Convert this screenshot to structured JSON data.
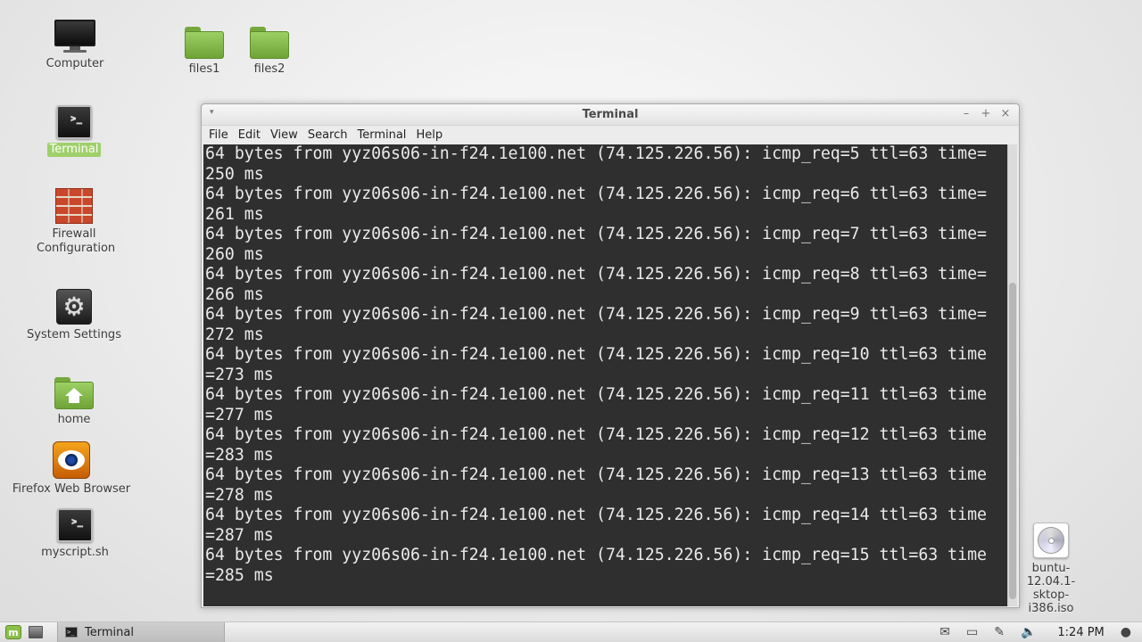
{
  "desktop": {
    "icons": [
      {
        "label": "Computer",
        "icon": "computer-icon"
      },
      {
        "label": "files1",
        "icon": "folder-icon"
      },
      {
        "label": "files2",
        "icon": "folder-icon"
      },
      {
        "label": "Terminal",
        "icon": "terminal-icon"
      },
      {
        "label": "Firewall Configuration",
        "icon": "firewall-icon"
      },
      {
        "label": "System Settings",
        "icon": "settings-icon"
      },
      {
        "label": "home",
        "icon": "home-folder-icon"
      },
      {
        "label": "Firefox Web Browser",
        "icon": "firefox-icon"
      },
      {
        "label": "myscript.sh",
        "icon": "script-icon"
      },
      {
        "label": "buntu-12.04.1-\nsktop-i386.iso",
        "icon": "iso-disc-icon"
      }
    ],
    "selected_icon": "Terminal"
  },
  "window": {
    "title": "Terminal",
    "menu_arrow": "▾",
    "controls": {
      "minimize": "–",
      "maximize": "+",
      "close": "×"
    },
    "menu": [
      "File",
      "Edit",
      "View",
      "Search",
      "Terminal",
      "Help"
    ]
  },
  "terminal": {
    "lines": [
      "64 bytes from yyz06s06-in-f24.1e100.net (74.125.226.56): icmp_req=5 ttl=63 time=",
      "250 ms",
      "64 bytes from yyz06s06-in-f24.1e100.net (74.125.226.56): icmp_req=6 ttl=63 time=",
      "261 ms",
      "64 bytes from yyz06s06-in-f24.1e100.net (74.125.226.56): icmp_req=7 ttl=63 time=",
      "260 ms",
      "64 bytes from yyz06s06-in-f24.1e100.net (74.125.226.56): icmp_req=8 ttl=63 time=",
      "266 ms",
      "64 bytes from yyz06s06-in-f24.1e100.net (74.125.226.56): icmp_req=9 ttl=63 time=",
      "272 ms",
      "64 bytes from yyz06s06-in-f24.1e100.net (74.125.226.56): icmp_req=10 ttl=63 time",
      "=273 ms",
      "64 bytes from yyz06s06-in-f24.1e100.net (74.125.226.56): icmp_req=11 ttl=63 time",
      "=277 ms",
      "64 bytes from yyz06s06-in-f24.1e100.net (74.125.226.56): icmp_req=12 ttl=63 time",
      "=283 ms",
      "64 bytes from yyz06s06-in-f24.1e100.net (74.125.226.56): icmp_req=13 ttl=63 time",
      "=278 ms",
      "64 bytes from yyz06s06-in-f24.1e100.net (74.125.226.56): icmp_req=14 ttl=63 time",
      "=287 ms",
      "64 bytes from yyz06s06-in-f24.1e100.net (74.125.226.56): icmp_req=15 ttl=63 time",
      "=285 ms"
    ],
    "background": "#2f2f2f",
    "foreground": "#eaeaea"
  },
  "panel": {
    "task_label": "Terminal",
    "clock": "1:24 PM",
    "tray_icons": [
      "mail-icon",
      "battery-icon",
      "network-icon",
      "volume-icon",
      "user-icon"
    ],
    "tray_glyphs": [
      "✉",
      "▭",
      "✎",
      "🔈",
      "●"
    ]
  }
}
